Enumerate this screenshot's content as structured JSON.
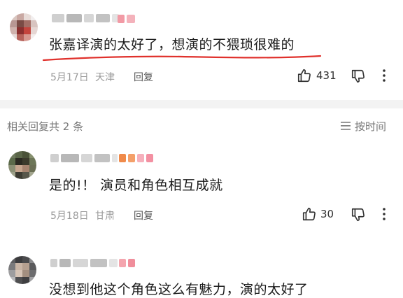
{
  "main_comment": {
    "text": "张嘉译演的太好了，想演的不猥琐很难的",
    "date": "5月17日",
    "location": "天津",
    "reply_label": "回复",
    "like_count": "431"
  },
  "replies_header": {
    "count_label": "相关回复共 2 条",
    "sort_label": "按时间"
  },
  "replies": [
    {
      "text": "是的!！ 演员和角色相互成就",
      "date": "5月18日",
      "location": "甘肃",
      "reply_label": "回复",
      "like_count": "30"
    },
    {
      "text": "没想到他这个角色这么有魅力，演的太好了"
    }
  ],
  "colors": {
    "underline": "#e0312c",
    "meta": "#9a9a9a",
    "divider": "#f3f3f3"
  }
}
